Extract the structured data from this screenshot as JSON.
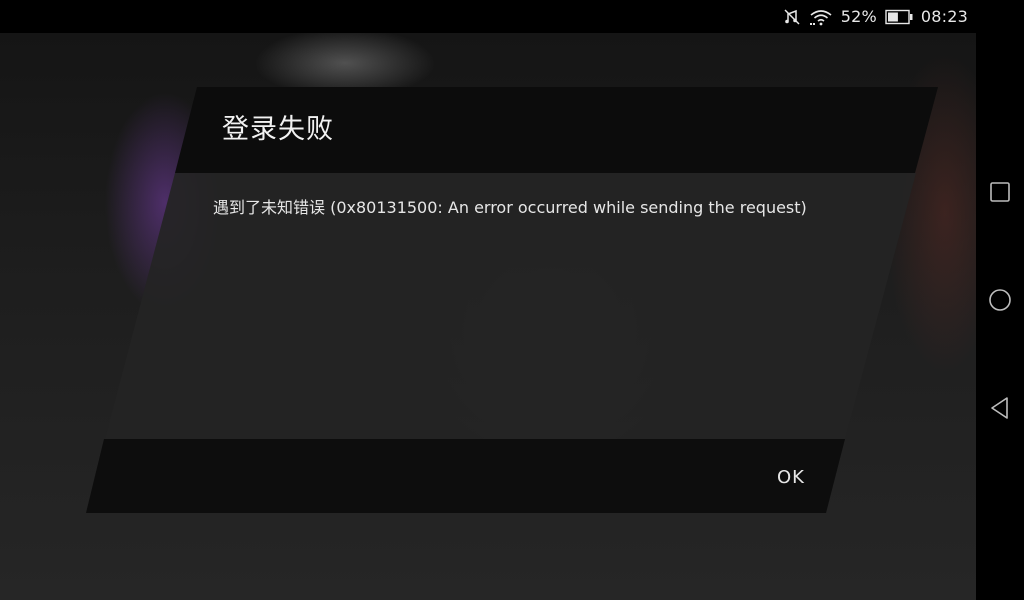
{
  "status_bar": {
    "battery_percent": "52%",
    "time": "08:23",
    "battery_level": 0.52,
    "icons": [
      "mute-icon",
      "wifi-icon",
      "battery-icon"
    ]
  },
  "dialog": {
    "title": "登录失败",
    "message": "遇到了未知错误 (0x80131500: An error occurred while sending the request)",
    "ok_label": "OK"
  },
  "nav_bar": {
    "buttons": [
      "recent-apps-button",
      "home-button",
      "back-button"
    ]
  },
  "colors": {
    "text": "#e6e6e6",
    "header_bg": "#0c0c0c",
    "body_bg": "#242424",
    "footer_bg": "#0d0d0d"
  }
}
